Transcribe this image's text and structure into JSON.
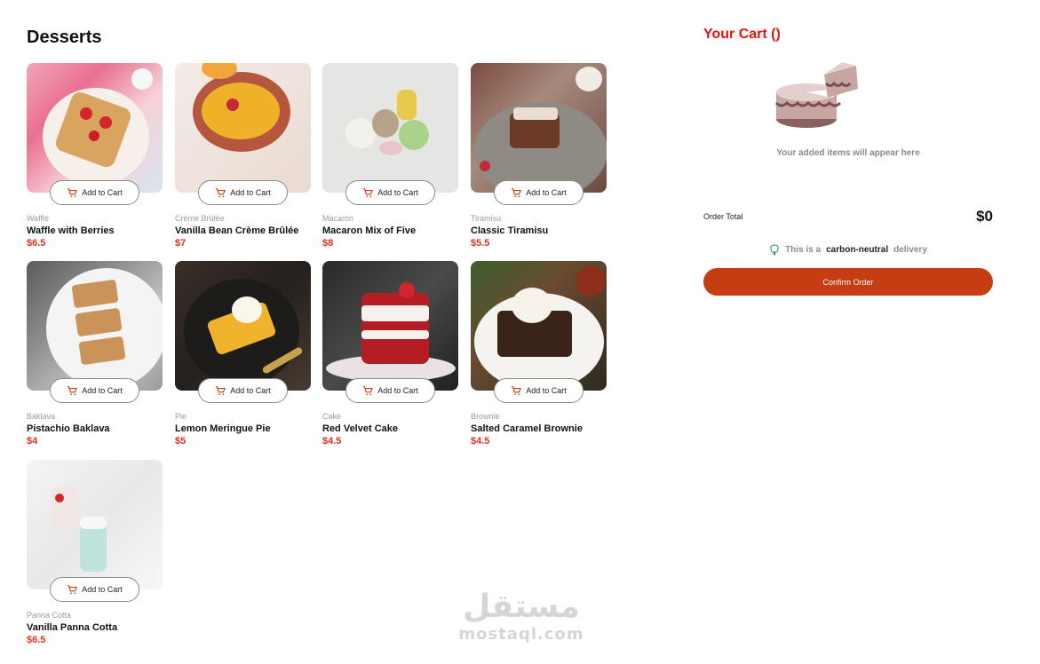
{
  "page": {
    "title": "Desserts"
  },
  "products": [
    {
      "category": "Waffle",
      "name": "Waffle with Berries",
      "price": "$6.5",
      "button": "Add to Cart"
    },
    {
      "category": "Crème Brûlée",
      "name": "Vanilla Bean Crème Brûlée",
      "price": "$7",
      "button": "Add to Cart"
    },
    {
      "category": "Macaron",
      "name": "Macaron Mix of Five",
      "price": "$8",
      "button": "Add to Cart"
    },
    {
      "category": "Tiramisu",
      "name": "Classic Tiramisu",
      "price": "$5.5",
      "button": "Add to Cart"
    },
    {
      "category": "Baklava",
      "name": "Pistachio Baklava",
      "price": "$4",
      "button": "Add to Cart"
    },
    {
      "category": "Pie",
      "name": "Lemon Meringue Pie",
      "price": "$5",
      "button": "Add to Cart"
    },
    {
      "category": "Cake",
      "name": "Red Velvet Cake",
      "price": "$4.5",
      "button": "Add to Cart"
    },
    {
      "category": "Brownie",
      "name": "Salted Caramel Brownie",
      "price": "$4.5",
      "button": "Add to Cart"
    },
    {
      "category": "Panna Cotta",
      "name": "Vanilla Panna Cotta",
      "price": "$6.5",
      "button": "Add to Cart"
    }
  ],
  "cart": {
    "title": "Your Cart ()",
    "empty_message": "Your added items will appear here",
    "order_total_label": "Order Total",
    "order_total_value": "$0",
    "carbon_prefix": "This is a",
    "carbon_bold": "carbon-neutral",
    "carbon_suffix": "delivery",
    "confirm_label": "Confirm Order"
  },
  "watermark": {
    "arabic": "مستقل",
    "latin": "mostaql.com"
  },
  "colors": {
    "accent_red": "#e0150f",
    "price_red": "#e0311f",
    "button_brown": "#c63d14"
  },
  "icons": [
    "cart-icon",
    "carbon-tree-icon",
    "empty-cart-cake-illustration"
  ]
}
